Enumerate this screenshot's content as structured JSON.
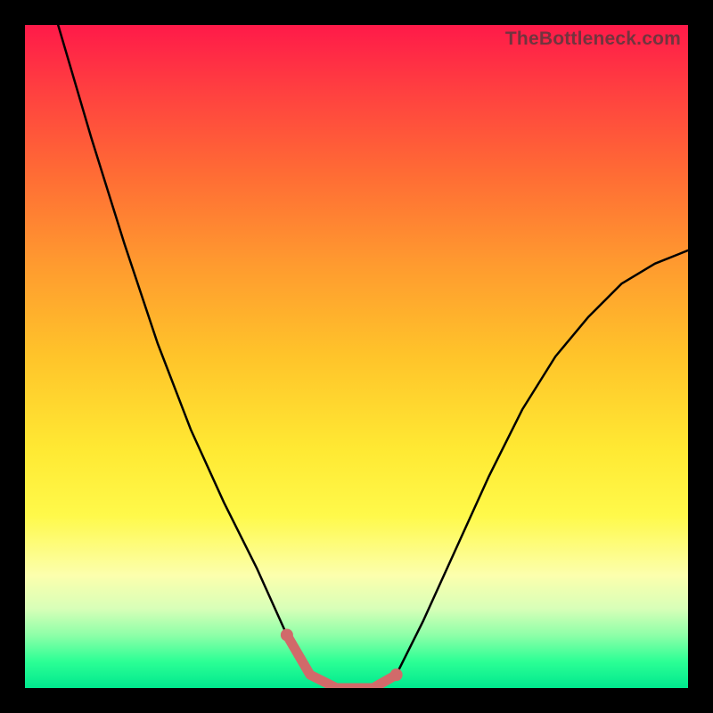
{
  "watermark": "TheBottleneck.com",
  "chart_data": {
    "type": "line",
    "title": "",
    "xlabel": "",
    "ylabel": "",
    "xlim": [
      0,
      1
    ],
    "ylim": [
      0,
      100
    ],
    "series": [
      {
        "name": "bottleneck-curve",
        "x": [
          0.0,
          0.05,
          0.1,
          0.15,
          0.2,
          0.25,
          0.3,
          0.35,
          0.395,
          0.43,
          0.47,
          0.5,
          0.525,
          0.56,
          0.6,
          0.65,
          0.7,
          0.75,
          0.8,
          0.85,
          0.9,
          0.95,
          1.0
        ],
        "y": [
          117,
          100,
          83,
          67,
          52,
          39,
          28,
          18,
          8,
          2,
          0,
          0,
          0,
          2,
          10,
          21,
          32,
          42,
          50,
          56,
          61,
          64,
          66
        ]
      }
    ],
    "highlight": {
      "name": "valley-highlight",
      "x": [
        0.395,
        0.43,
        0.47,
        0.5,
        0.525,
        0.56
      ],
      "y": [
        8,
        2,
        0,
        0,
        0,
        2
      ],
      "color": "#d16a6a"
    },
    "gradient_background": {
      "stops": [
        {
          "pct": 0,
          "color": "#ff1a49"
        },
        {
          "pct": 10,
          "color": "#ff4040"
        },
        {
          "pct": 22,
          "color": "#ff6a35"
        },
        {
          "pct": 36,
          "color": "#ff9a2f"
        },
        {
          "pct": 50,
          "color": "#ffc42a"
        },
        {
          "pct": 64,
          "color": "#ffe933"
        },
        {
          "pct": 74,
          "color": "#fff94a"
        },
        {
          "pct": 83,
          "color": "#fcffad"
        },
        {
          "pct": 88,
          "color": "#d8ffb8"
        },
        {
          "pct": 92,
          "color": "#8effa8"
        },
        {
          "pct": 96,
          "color": "#2cff95"
        },
        {
          "pct": 100,
          "color": "#00e88e"
        }
      ]
    }
  }
}
